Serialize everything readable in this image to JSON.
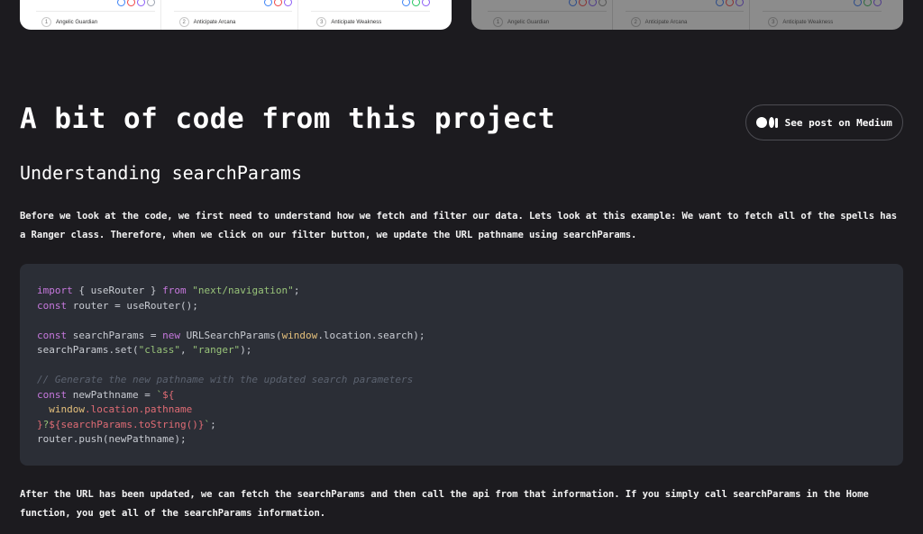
{
  "preview_cards": [
    {
      "theme": "light",
      "items": [
        {
          "number": "1",
          "label": "Angelic Guardian"
        },
        {
          "number": "2",
          "label": "Anticipate Arcana"
        },
        {
          "number": "3",
          "label": "Anticipate Weakness"
        }
      ]
    },
    {
      "theme": "dimmed",
      "items": [
        {
          "number": "1",
          "label": "Angelic Guardian"
        },
        {
          "number": "2",
          "label": "Anticipate Arcana"
        },
        {
          "number": "3",
          "label": "Anticipate Weakness"
        }
      ]
    }
  ],
  "section": {
    "title": "A bit of code from this project",
    "medium_button": {
      "label": "See post on Medium",
      "icon": "medium-logo-icon"
    },
    "subtitle": "Understanding searchParams",
    "intro_text": "Before we look at the code, we first need to understand how we fetch and filter our data. Lets look at this example: We want to fetch all of the spells has a Ranger class. Therefore, when we click on our filter button, we update the URL pathname using searchParams.",
    "outro_text": "After the URL has been updated, we can fetch the searchParams and then call the api from that information. If you simply call searchParams in the Home function, you get all of the searchParams information."
  },
  "code": {
    "lines": [
      [
        {
          "t": "kw",
          "v": "import"
        },
        {
          "t": "plain",
          "v": " { useRouter } "
        },
        {
          "t": "kw",
          "v": "from"
        },
        {
          "t": "plain",
          "v": " "
        },
        {
          "t": "str",
          "v": "\"next/navigation\""
        },
        {
          "t": "plain",
          "v": ";"
        }
      ],
      [
        {
          "t": "kw",
          "v": "const"
        },
        {
          "t": "plain",
          "v": " router = useRouter();"
        }
      ],
      [],
      [
        {
          "t": "kw",
          "v": "const"
        },
        {
          "t": "plain",
          "v": " searchParams = "
        },
        {
          "t": "kw",
          "v": "new"
        },
        {
          "t": "plain",
          "v": " URLSearchParams("
        },
        {
          "t": "glob",
          "v": "window"
        },
        {
          "t": "plain",
          "v": ".location.search);"
        }
      ],
      [
        {
          "t": "plain",
          "v": "searchParams.set("
        },
        {
          "t": "str",
          "v": "\"class\""
        },
        {
          "t": "plain",
          "v": ", "
        },
        {
          "t": "str",
          "v": "\"ranger\""
        },
        {
          "t": "plain",
          "v": ");"
        }
      ],
      [],
      [
        {
          "t": "cm",
          "v": "// Generate the new pathname with the updated search parameters"
        }
      ],
      [
        {
          "t": "kw",
          "v": "const"
        },
        {
          "t": "plain",
          "v": " newPathname = "
        },
        {
          "t": "str",
          "v": "`"
        },
        {
          "t": "tpl",
          "v": "${"
        }
      ],
      [
        {
          "t": "plain",
          "v": "  "
        },
        {
          "t": "glob",
          "v": "window"
        },
        {
          "t": "tpl",
          "v": ".location.pathname"
        }
      ],
      [
        {
          "t": "tpl",
          "v": "}"
        },
        {
          "t": "str",
          "v": "?"
        },
        {
          "t": "tpl",
          "v": "${searchParams.toString()}"
        },
        {
          "t": "str",
          "v": "`"
        },
        {
          "t": "plain",
          "v": ";"
        }
      ],
      [
        {
          "t": "plain",
          "v": "router.push(newPathname);"
        }
      ]
    ]
  },
  "colors": {
    "background": "#1c1b1f",
    "code_background": "#2b2e36",
    "keyword": "#c678dd",
    "string": "#98c379",
    "global": "#e5c07b",
    "comment": "#5c6370",
    "template": "#e06c75",
    "badge_blue": "#3b82f6",
    "badge_red": "#ef4444",
    "badge_purple": "#8b5cf6",
    "badge_gray": "#9ca3af",
    "badge_green": "#22c55e"
  }
}
